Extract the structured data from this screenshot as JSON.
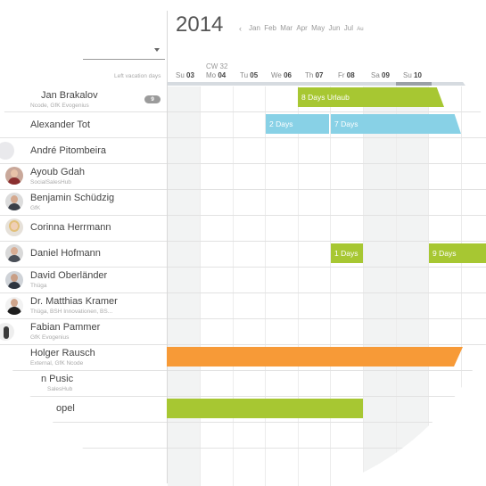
{
  "header": {
    "year": "2014",
    "prev_icon": "chevron-left-icon",
    "months": [
      "Jan",
      "Feb",
      "Mar",
      "Apr",
      "May",
      "Jun",
      "Jul",
      "Au"
    ],
    "left_vacation_label": "Left vacation days",
    "calendar_week": "CW 32",
    "days": [
      {
        "dow": "Su",
        "num": "03"
      },
      {
        "dow": "Mo",
        "num": "04"
      },
      {
        "dow": "Tu",
        "num": "05"
      },
      {
        "dow": "We",
        "num": "06"
      },
      {
        "dow": "Th",
        "num": "07"
      },
      {
        "dow": "Fr",
        "num": "08"
      },
      {
        "dow": "Sa",
        "num": "09"
      },
      {
        "dow": "Su",
        "num": "10"
      }
    ]
  },
  "people": [
    {
      "name": "Jan Brakalov",
      "sub": "Ncode, GfK Evogenius",
      "badge": "9"
    },
    {
      "name": "Alexander Tot",
      "sub": ""
    },
    {
      "name": "André Pitombeira",
      "sub": ""
    },
    {
      "name": "Ayoub Gdah",
      "sub": "SocialSalesHub"
    },
    {
      "name": "Benjamin Schüdzig",
      "sub": "GfK"
    },
    {
      "name": "Corinna Herrmann",
      "sub": ""
    },
    {
      "name": "Daniel Hofmann",
      "sub": ""
    },
    {
      "name": "David Oberländer",
      "sub": "Thüga"
    },
    {
      "name": "Dr. Matthias Kramer",
      "sub": "Thüga, BSH Innovationen, BS..."
    },
    {
      "name": "Fabian Pammer",
      "sub": "GfK Evogenius"
    },
    {
      "name": "Holger Rausch",
      "sub": "External, GfK Ncode"
    },
    {
      "name": "n Pusic",
      "sub": "SalesHub"
    },
    {
      "name": "opel",
      "sub": ""
    }
  ],
  "bars": {
    "jan_vacation": "8 Days Urlaub",
    "alex_a": "2 Days",
    "alex_b": "7 Days",
    "daniel_a": "1 Days",
    "daniel_b": "9 Days"
  },
  "colors": {
    "green": "#a7c732",
    "blue": "#88d1e6",
    "orange": "#f79a37"
  }
}
